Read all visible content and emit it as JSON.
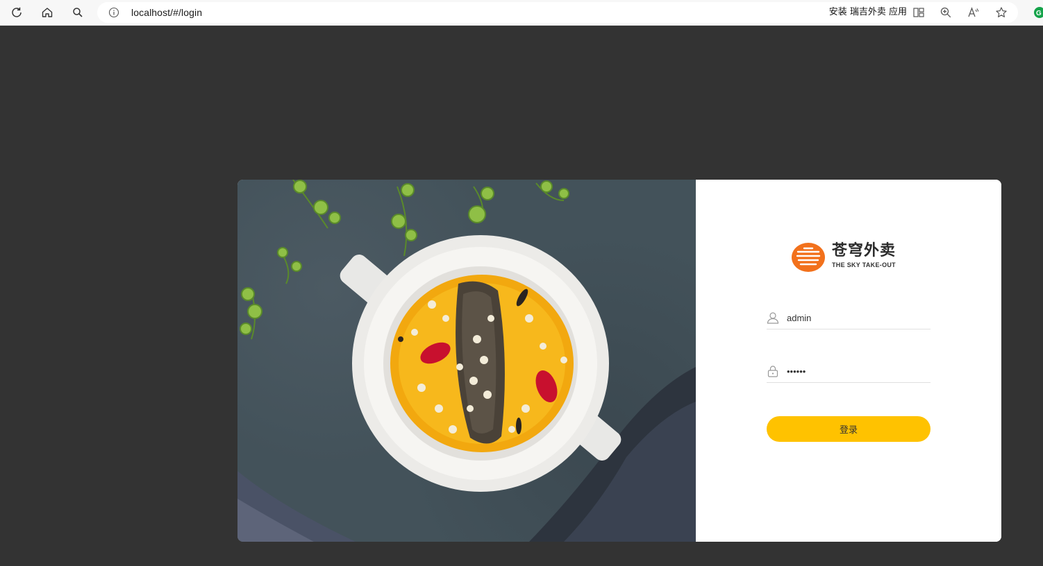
{
  "browser": {
    "url": "localhost/#/login",
    "install_label": "安装 瑞吉外卖 应用",
    "icons": [
      "refresh-icon",
      "home-icon",
      "search-icon",
      "info-icon",
      "app-icon",
      "zoom-icon",
      "read-aloud-icon",
      "favorite-icon",
      "extension-icon"
    ]
  },
  "login": {
    "logo_cn": "苍穹外卖",
    "logo_en": "THE SKY TAKE-OUT",
    "username_value": "admin",
    "password_value": "123456",
    "submit_label": "登录"
  },
  "colors": {
    "page_bg": "#333333",
    "accent": "#ffc200",
    "logo_orange": "#f2711c"
  }
}
